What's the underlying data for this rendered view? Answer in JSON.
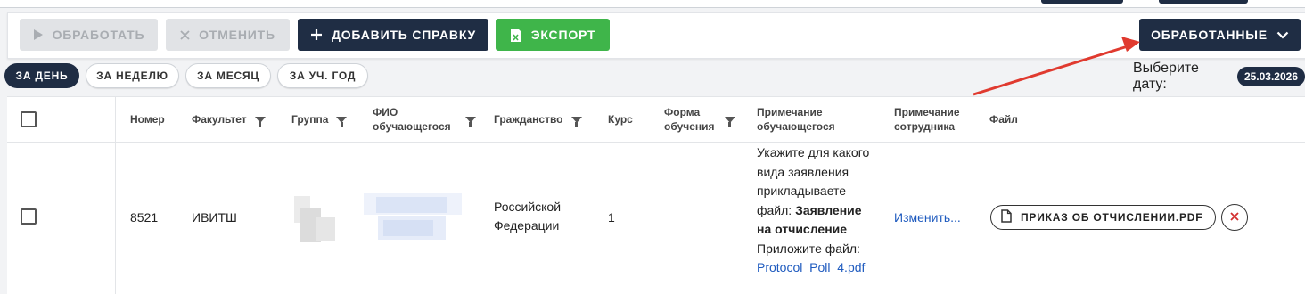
{
  "toolbar": {
    "process_label": "ОБРАБОТАТЬ",
    "cancel_label": "ОТМЕНИТЬ",
    "add_cert_label": "ДОБАВИТЬ СПРАВКУ",
    "export_label": "ЭКСПОРТ",
    "processed_label": "ОБРАБОТАННЫЕ"
  },
  "periods": [
    "ЗА ДЕНЬ",
    "ЗА НЕДЕЛЮ",
    "ЗА МЕСЯЦ",
    "ЗА УЧ. ГОД"
  ],
  "active_period": "ЗА ДЕНЬ",
  "date": {
    "label": "Выберите дату:",
    "value": "25.03.2026"
  },
  "table": {
    "columns": {
      "number": "Номер",
      "faculty": "Факультет",
      "group": "Группа",
      "fio_line1": "ФИО",
      "fio_line2": "обучающегося",
      "citizenship": "Гражданство",
      "course": "Курс",
      "form_line1": "Форма",
      "form_line2": "обучения",
      "note_line1": "Примечание",
      "note_line2": "обучающегося",
      "staff_note_line1": "Примечание",
      "staff_note_line2": "сотрудника",
      "file": "Файл"
    },
    "rows": [
      {
        "number": "8521",
        "faculty": "ИВИТШ",
        "citizenship_line1": "Российской",
        "citizenship_line2": "Федерации",
        "course": "1",
        "note_text": "Укажите для какого вида заявления прикладываете файл: ",
        "note_bold": "Заявление на отчисление",
        "note_attach": "Приложите файл:",
        "note_link": "Protocol_Poll_4.pdf",
        "staff_note_link": "Изменить...",
        "file_name": "ПРИКАЗ ОБ ОТЧИСЛЕНИИ.PDF"
      }
    ]
  },
  "colors": {
    "navy": "#1f2d44",
    "green": "#3fb54a",
    "arrow": "#e03a2f",
    "link": "#1f5bbf",
    "delete": "#d32f2f"
  },
  "icons": [
    "play-icon",
    "close-icon",
    "plus-icon",
    "excel-file-icon",
    "chevron-down-icon",
    "filter-icon",
    "document-icon",
    "delete-x-icon"
  ]
}
